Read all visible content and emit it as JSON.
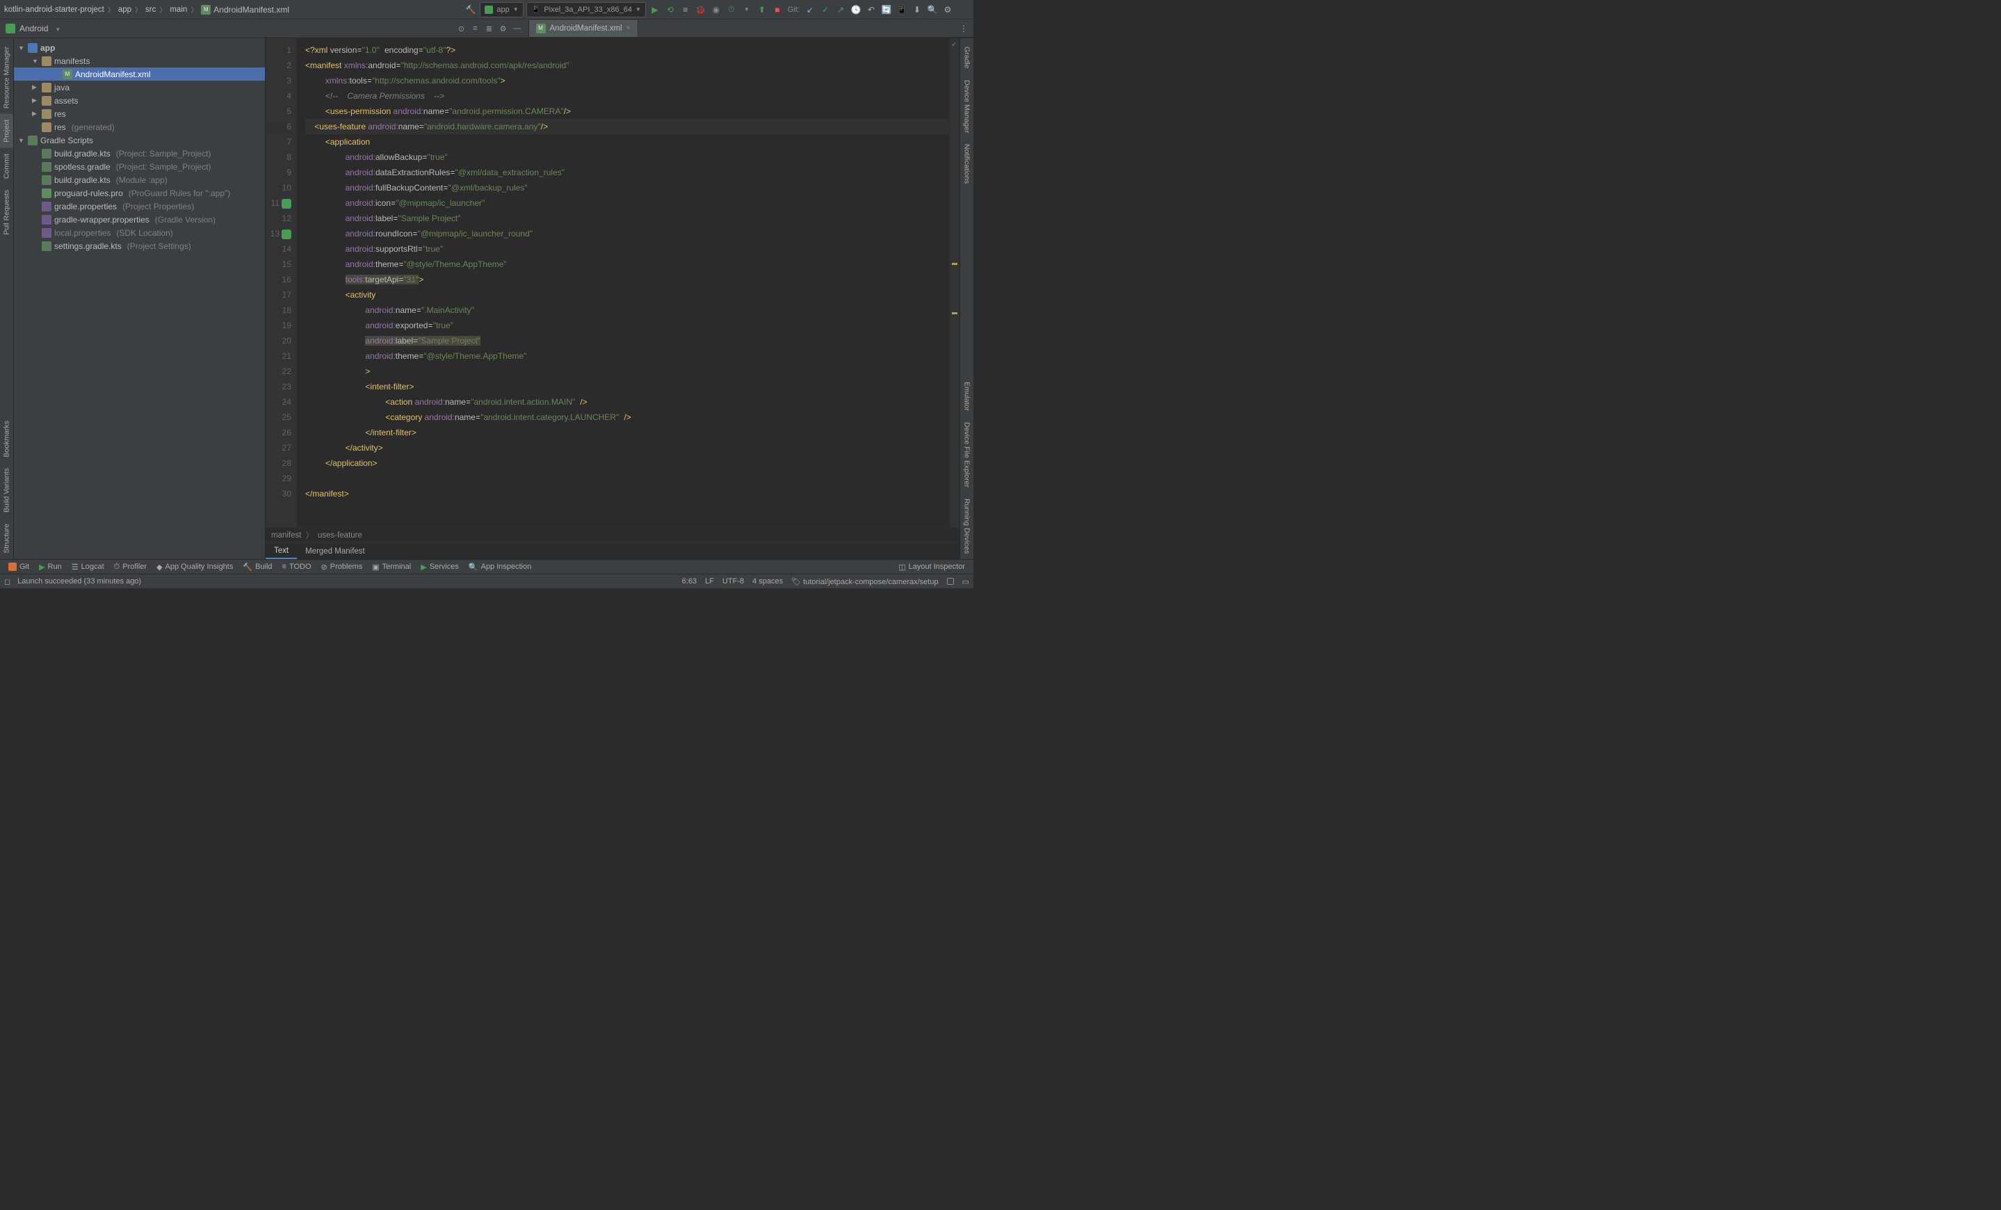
{
  "breadcrumbs": [
    "kotlin-android-starter-project",
    "app",
    "src",
    "main",
    "AndroidManifest.xml"
  ],
  "run_config": {
    "name": "app",
    "device": "Pixel_3a_API_33_x86_64"
  },
  "git_label": "Git:",
  "project_dropdown": "Android",
  "tree": {
    "app": "app",
    "manifests": "manifests",
    "manifest_file": "AndroidManifest.xml",
    "java": "java",
    "assets": "assets",
    "res": "res",
    "res_gen": "res",
    "res_gen_hint": "(generated)",
    "gradle_scripts": "Gradle Scripts",
    "build_proj": "build.gradle.kts",
    "build_proj_hint": "(Project: Sample_Project)",
    "spotless": "spotless.gradle",
    "spotless_hint": "(Project: Sample_Project)",
    "build_mod": "build.gradle.kts",
    "build_mod_hint": "(Module :app)",
    "proguard": "proguard-rules.pro",
    "proguard_hint": "(ProGuard Rules for \":app\")",
    "gradle_prop": "gradle.properties",
    "gradle_prop_hint": "(Project Properties)",
    "wrapper": "gradle-wrapper.properties",
    "wrapper_hint": "(Gradle Version)",
    "local_prop": "local.properties",
    "local_prop_hint": "(SDK Location)",
    "settings": "settings.gradle.kts",
    "settings_hint": "(Project Settings)"
  },
  "editor_tab": "AndroidManifest.xml",
  "code_lines": {
    "l1": "<?xml version=\"1.0\" encoding=\"utf-8\"?>",
    "l2": "<manifest xmlns:android=\"http://schemas.android.com/apk/res/android\"",
    "l3": "    xmlns:tools=\"http://schemas.android.com/tools\">",
    "l4": "    <!--    Camera Permissions    -->",
    "l5": "    <uses-permission android:name=\"android.permission.CAMERA\"/>",
    "l6": "    <uses-feature android:name=\"android.hardware.camera.any\"/>",
    "l7": "    <application",
    "l8": "        android:allowBackup=\"true\"",
    "l9": "        android:dataExtractionRules=\"@xml/data_extraction_rules\"",
    "l10": "        android:fullBackupContent=\"@xml/backup_rules\"",
    "l11": "        android:icon=\"@mipmap/ic_launcher\"",
    "l12": "        android:label=\"Sample Project\"",
    "l13": "        android:roundIcon=\"@mipmap/ic_launcher_round\"",
    "l14": "        android:supportsRtl=\"true\"",
    "l15": "        android:theme=\"@style/Theme.AppTheme\"",
    "l16": "        tools:targetApi=\"31\">",
    "l17": "        <activity",
    "l18": "            android:name=\".MainActivity\"",
    "l19": "            android:exported=\"true\"",
    "l20": "            android:label=\"Sample Project\"",
    "l21": "            android:theme=\"@style/Theme.AppTheme\"",
    "l22": "            >",
    "l23": "            <intent-filter>",
    "l24": "                <action android:name=\"android.intent.action.MAIN\" />",
    "l25": "                <category android:name=\"android.intent.category.LAUNCHER\" />",
    "l26": "            </intent-filter>",
    "l27": "        </activity>",
    "l28": "    </application>",
    "l29": "",
    "l30": "</manifest>"
  },
  "editor_breadcrumb": [
    "manifest",
    "uses-feature"
  ],
  "editor_bottom_tabs": {
    "text": "Text",
    "merged": "Merged Manifest"
  },
  "left_rail": {
    "resource_mgr": "Resource Manager",
    "project": "Project",
    "commit": "Commit",
    "pull_requests": "Pull Requests",
    "bookmarks": "Bookmarks",
    "build_variants": "Build Variants",
    "structure": "Structure"
  },
  "right_rail": {
    "gradle": "Gradle",
    "device_mgr": "Device Manager",
    "notifications": "Notifications",
    "emulator": "Emulator",
    "device_file_explorer": "Device File Explorer",
    "running_devices": "Running Devices"
  },
  "bottom_tw": {
    "git": "Git",
    "run": "Run",
    "logcat": "Logcat",
    "profiler": "Profiler",
    "app_quality": "App Quality Insights",
    "build": "Build",
    "todo": "TODO",
    "problems": "Problems",
    "terminal": "Terminal",
    "services": "Services",
    "app_inspection": "App Inspection",
    "layout_inspector": "Layout Inspector"
  },
  "status": {
    "launch": "Launch succeeded (33 minutes ago)",
    "pos": "6:63",
    "lf": "LF",
    "encoding": "UTF-8",
    "indent": "4 spaces",
    "branch": "tutorial/jetpack-compose/camerax/setup"
  }
}
